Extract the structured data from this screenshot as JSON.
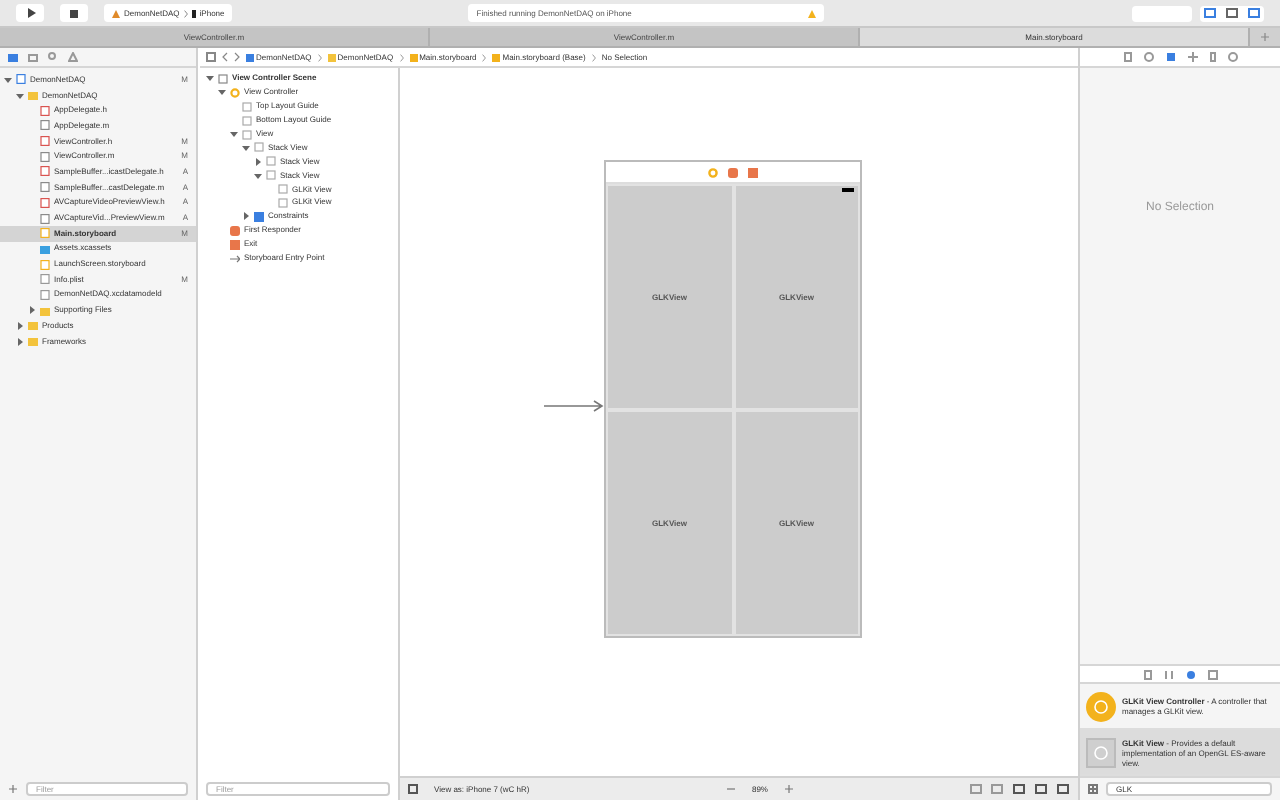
{
  "toolbar": {
    "scheme": "DemonNetDAQ",
    "device": "iPhone",
    "status": "Finished running DemonNetDAQ on iPhone"
  },
  "tabs": [
    {
      "label": "ViewController.m",
      "selected": false
    },
    {
      "label": "ViewController.m",
      "selected": false
    },
    {
      "label": "Main.storyboard",
      "selected": true
    }
  ],
  "navigator": {
    "items": [
      {
        "name": "DemonNetDAQ",
        "kind": "project",
        "status": "M",
        "expanded": true,
        "selected": false,
        "children": [
          {
            "name": "DemonNetDAQ",
            "kind": "folder",
            "expanded": true,
            "selected": false,
            "children": [
              {
                "name": "AppDelegate.h",
                "kind": "header",
                "selected": false
              },
              {
                "name": "AppDelegate.m",
                "kind": "source",
                "selected": false
              },
              {
                "name": "ViewController.h",
                "kind": "header",
                "status": "M",
                "selected": false
              },
              {
                "name": "ViewController.m",
                "kind": "source",
                "status": "M",
                "selected": false
              },
              {
                "name": "SampleBuffer...icastDelegate.h",
                "kind": "header",
                "status": "A",
                "selected": false
              },
              {
                "name": "SampleBuffer...castDelegate.m",
                "kind": "source",
                "status": "A",
                "selected": false
              },
              {
                "name": "AVCaptureVideoPreviewView.h",
                "kind": "header",
                "status": "A",
                "selected": false
              },
              {
                "name": "AVCaptureVid...PreviewView.m",
                "kind": "source",
                "status": "A",
                "selected": false
              },
              {
                "name": "Main.storyboard",
                "kind": "storyboard",
                "status": "M",
                "selected": true
              },
              {
                "name": "Assets.xcassets",
                "kind": "assets",
                "selected": false
              },
              {
                "name": "LaunchScreen.storyboard",
                "kind": "storyboard",
                "selected": false
              },
              {
                "name": "Info.plist",
                "kind": "plist",
                "status": "M",
                "selected": false
              },
              {
                "name": "DemonNetDAQ.xcdatamodeld",
                "kind": "model",
                "selected": false
              },
              {
                "name": "Supporting Files",
                "kind": "folder",
                "expanded": false,
                "selected": false
              }
            ]
          },
          {
            "name": "Products",
            "kind": "folder",
            "expanded": false,
            "selected": false
          },
          {
            "name": "Frameworks",
            "kind": "folder",
            "expanded": false,
            "selected": false
          }
        ]
      }
    ],
    "filter": {
      "placeholder": "Filter"
    }
  },
  "jump_bar": [
    "DemonNetDAQ",
    "DemonNetDAQ",
    "Main.storyboard",
    "Main.storyboard (Base)",
    "No Selection"
  ],
  "outline": {
    "items": [
      {
        "name": "View Controller Scene",
        "kind": "scene",
        "expanded": true,
        "children": [
          {
            "name": "View Controller",
            "kind": "controller",
            "expanded": true,
            "children": [
              {
                "name": "Top Layout Guide",
                "kind": "view"
              },
              {
                "name": "Bottom Layout Guide",
                "kind": "view"
              },
              {
                "name": "View",
                "kind": "view",
                "expanded": true,
                "children": [
                  {
                    "name": "Stack View",
                    "kind": "stack",
                    "expanded": true,
                    "children": [
                      {
                        "name": "Stack View",
                        "kind": "stack",
                        "expanded": false
                      },
                      {
                        "name": "Stack View",
                        "kind": "stack",
                        "expanded": true,
                        "children": [
                          {
                            "name": "GLKit View",
                            "kind": "glk"
                          },
                          {
                            "name": "GLKit View",
                            "kind": "glk"
                          }
                        ]
                      }
                    ]
                  },
                  {
                    "name": "Constraints",
                    "kind": "constraints",
                    "expanded": false
                  }
                ]
              }
            ]
          },
          {
            "name": "First Responder",
            "kind": "responder"
          },
          {
            "name": "Exit",
            "kind": "exit"
          },
          {
            "name": "Storyboard Entry Point",
            "kind": "entry"
          }
        ]
      }
    ],
    "filter": {
      "placeholder": "Filter"
    }
  },
  "canvas": {
    "cells": [
      "GLKView",
      "GLKView",
      "GLKView",
      "GLKView"
    ],
    "view_as": "View as: iPhone 7 (wC hR)",
    "zoom": "89%"
  },
  "inspector": {
    "message": "No Selection"
  },
  "library": {
    "items": [
      {
        "title": "GLKit View Controller",
        "description": " - A controller that manages a GLKit view.",
        "kind": "controller",
        "selected": false
      },
      {
        "title": "GLKit View",
        "description": " - Provides a default implementation of an OpenGL ES-aware view.",
        "kind": "view",
        "selected": true
      }
    ],
    "search": {
      "value": "GLK"
    }
  }
}
